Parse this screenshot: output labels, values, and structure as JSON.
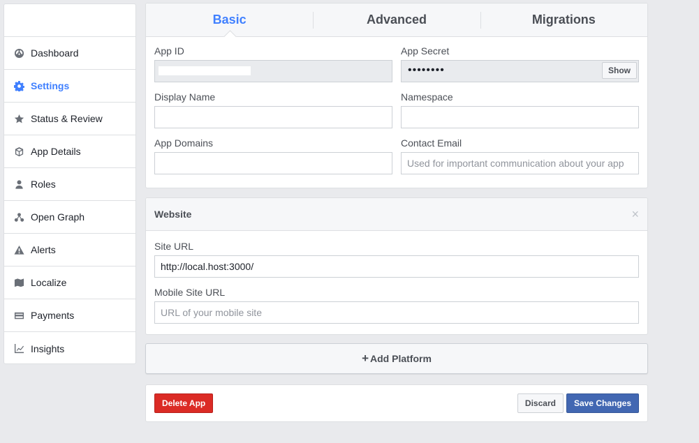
{
  "sidebar": {
    "items": [
      {
        "label": "Dashboard",
        "icon": "dashboard-icon"
      },
      {
        "label": "Settings",
        "icon": "gear-icon",
        "active": true
      },
      {
        "label": "Status & Review",
        "icon": "star-icon"
      },
      {
        "label": "App Details",
        "icon": "cube-icon"
      },
      {
        "label": "Roles",
        "icon": "person-icon"
      },
      {
        "label": "Open Graph",
        "icon": "graph-nodes-icon"
      },
      {
        "label": "Alerts",
        "icon": "warning-icon"
      },
      {
        "label": "Localize",
        "icon": "flag-map-icon"
      },
      {
        "label": "Payments",
        "icon": "credit-card-icon"
      },
      {
        "label": "Insights",
        "icon": "line-chart-icon"
      }
    ]
  },
  "tabs": [
    {
      "label": "Basic",
      "active": true
    },
    {
      "label": "Advanced"
    },
    {
      "label": "Migrations"
    }
  ],
  "basic": {
    "app_id_label": "App ID",
    "app_secret_label": "App Secret",
    "app_secret_masked": "••••••••",
    "show_label": "Show",
    "display_name_label": "Display Name",
    "display_name_value": "",
    "namespace_label": "Namespace",
    "namespace_value": "",
    "app_domains_label": "App Domains",
    "app_domains_value": "",
    "contact_email_label": "Contact Email",
    "contact_email_placeholder": "Used for important communication about your app"
  },
  "website": {
    "title": "Website",
    "close_glyph": "×",
    "site_url_label": "Site URL",
    "site_url_value": "http://local.host:3000/",
    "mobile_site_url_label": "Mobile Site URL",
    "mobile_site_url_placeholder": "URL of your mobile site"
  },
  "platform": {
    "plus": "+",
    "label": "Add Platform"
  },
  "actions": {
    "delete_label": "Delete App",
    "discard_label": "Discard",
    "save_label": "Save Changes"
  },
  "colors": {
    "accent": "#4080ff",
    "delete": "#db2b25",
    "save": "#4267b2",
    "background": "#e9eaed"
  }
}
